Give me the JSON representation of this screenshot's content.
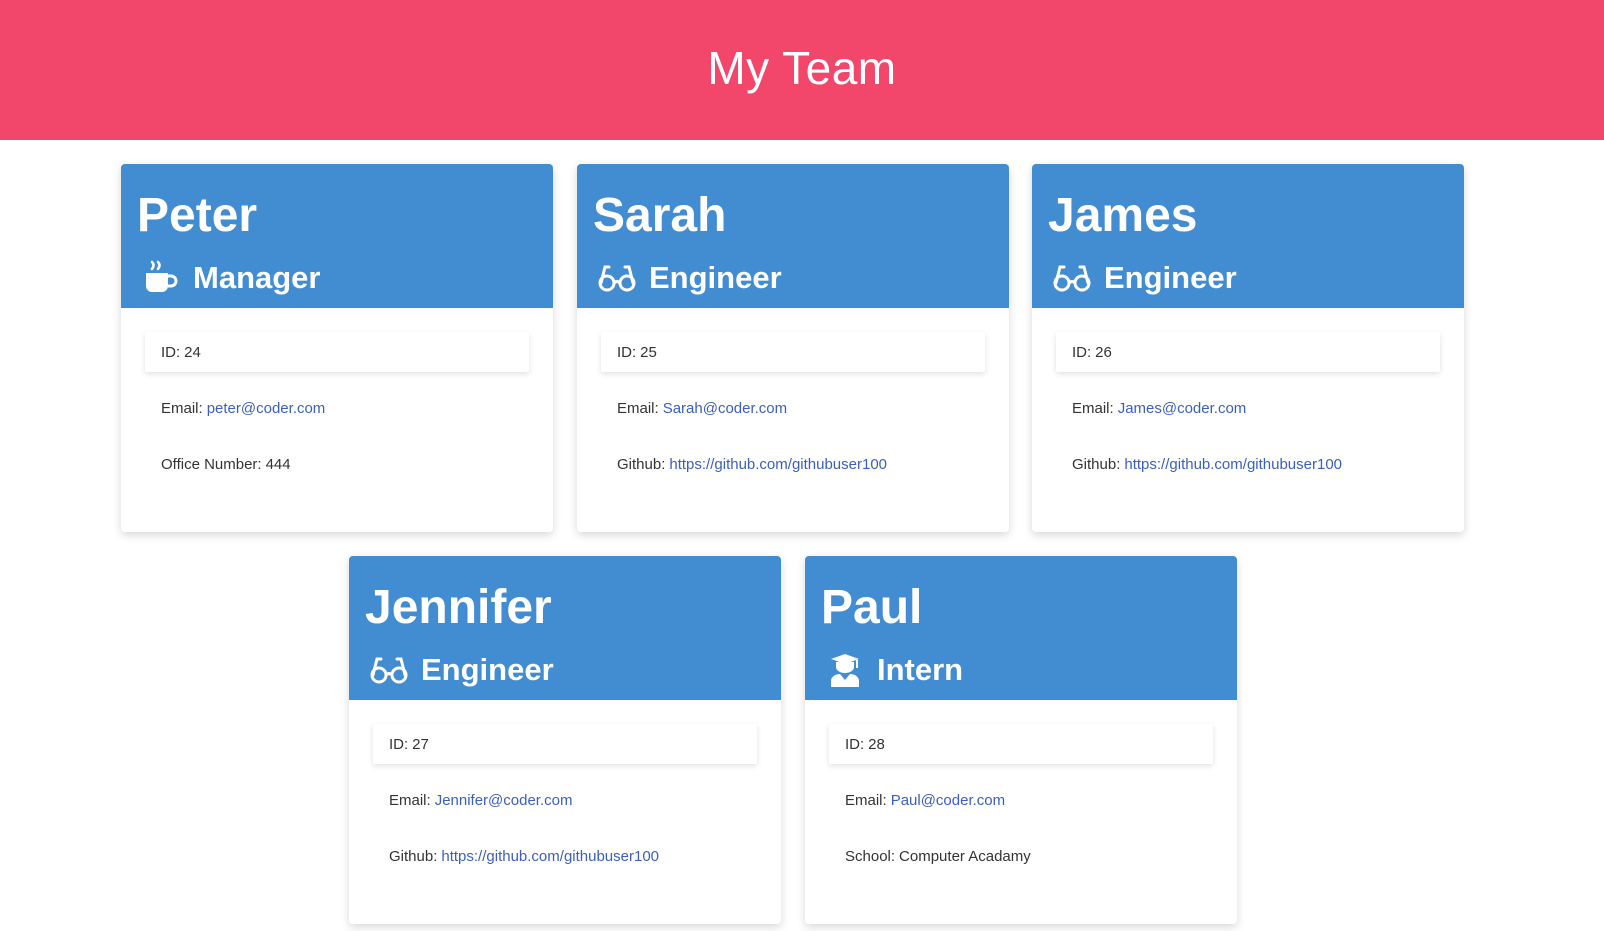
{
  "header": {
    "title": "My Team"
  },
  "colors": {
    "header_bg": "#f2476a",
    "card_header_bg": "#428dd1",
    "link": "#3b5fc0"
  },
  "cards": [
    {
      "name": "Peter",
      "role": "Manager",
      "icon": "mug-icon",
      "id_label": "ID:",
      "id_value": "24",
      "email_label": "Email:",
      "email": "peter@coder.com",
      "extra_label": "Office Number:",
      "extra_value": "444"
    },
    {
      "name": "Sarah",
      "role": "Engineer",
      "icon": "glasses-icon",
      "id_label": "ID:",
      "id_value": "25",
      "email_label": "Email:",
      "email": "Sarah@coder.com",
      "extra_label": "Github:",
      "extra_value": "https://github.com/githubuser100"
    },
    {
      "name": "James",
      "role": "Engineer",
      "icon": "glasses-icon",
      "id_label": "ID:",
      "id_value": "26",
      "email_label": "Email:",
      "email": "James@coder.com",
      "extra_label": "Github:",
      "extra_value": "https://github.com/githubuser100"
    },
    {
      "name": "Jennifer",
      "role": "Engineer",
      "icon": "glasses-icon",
      "id_label": "ID:",
      "id_value": "27",
      "email_label": "Email:",
      "email": "Jennifer@coder.com",
      "extra_label": "Github:",
      "extra_value": "https://github.com/githubuser100"
    },
    {
      "name": "Paul",
      "role": "Intern",
      "icon": "graduate-icon",
      "id_label": "ID:",
      "id_value": "28",
      "email_label": "Email:",
      "email": "Paul@coder.com",
      "extra_label": "School:",
      "extra_value": "Computer Acadamy"
    }
  ]
}
